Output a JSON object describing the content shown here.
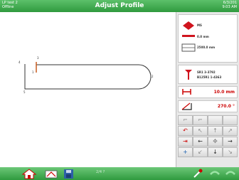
{
  "header": {
    "machine": "LP test 2",
    "status": "Offline",
    "title": "Adjust Profile",
    "date": "6/3/201",
    "time": "9:03 AM"
  },
  "drawing": {
    "labels": [
      "1",
      "2",
      "3",
      "4",
      "5"
    ]
  },
  "panel": {
    "material": "MS",
    "thickness": "0.8 mm",
    "length": "2500.0 mm",
    "tool_top": "SR1 3-3792",
    "tool_bottom": "B125R1 1-4363",
    "length_value": "10.0 mm",
    "angle_value": "270.0 °"
  },
  "keypad": {
    "left_arrow": "←",
    "right_arrow": "→",
    "down_arrow": "↓"
  },
  "footer": {
    "page": "2/4 ?"
  },
  "colors": {
    "header_green": "#3aa84a",
    "accent_red": "#cc0000"
  }
}
